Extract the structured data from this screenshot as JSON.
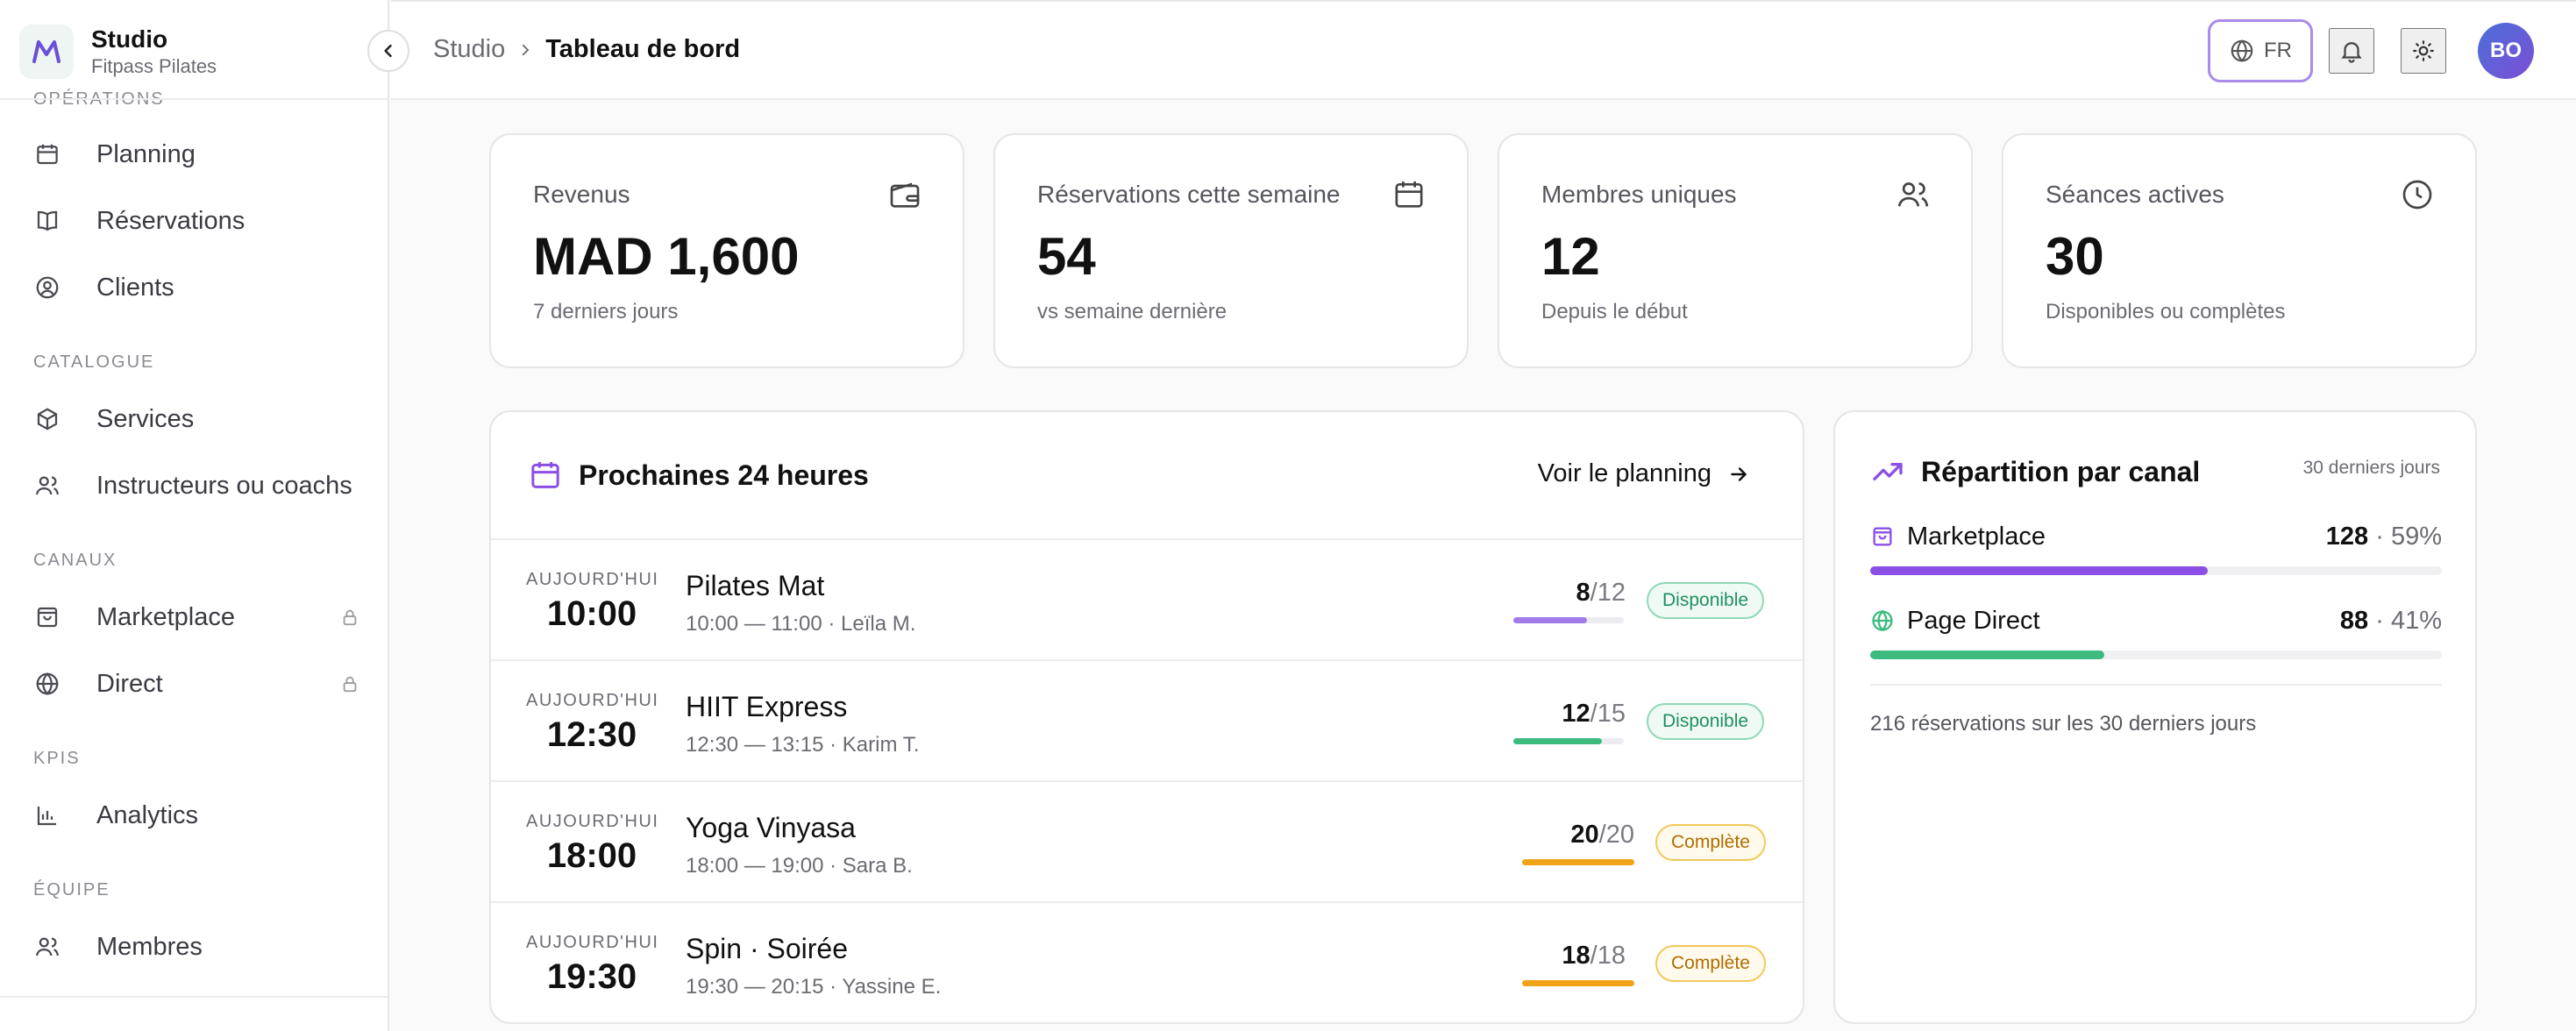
{
  "brand": {
    "name": "Studio",
    "subtitle": "Fitpass Pilates"
  },
  "sidebar": {
    "cut_section": "OPÉRATIONS",
    "sections": {
      "catalogue": "CATALOGUE",
      "canaux": "CANAUX",
      "kpis": "KPIS",
      "equipe": "ÉQUIPE"
    },
    "items": {
      "planning": "Planning",
      "reservations": "Réservations",
      "clients": "Clients",
      "services": "Services",
      "instructeurs": "Instructeurs ou coachs",
      "marketplace": "Marketplace",
      "direct": "Direct",
      "analytics": "Analytics",
      "membres": "Membres"
    }
  },
  "topbar": {
    "breadcrumb_root": "Studio",
    "breadcrumb_current": "Tableau de bord",
    "language": "FR",
    "avatar_initials": "BO"
  },
  "kpis": [
    {
      "label": "Revenus",
      "value": "MAD 1,600",
      "sub": "7 derniers jours"
    },
    {
      "label": "Réservations cette semaine",
      "value": "54",
      "sub": "vs semaine dernière"
    },
    {
      "label": "Membres uniques",
      "value": "12",
      "sub": "Depuis le début"
    },
    {
      "label": "Séances actives",
      "value": "30",
      "sub": "Disponibles ou complètes"
    }
  ],
  "upcoming": {
    "title": "Prochaines 24 heures",
    "see_planning": "Voir le planning",
    "sessions": [
      {
        "day": "AUJOURD'HUI",
        "time": "10:00",
        "name": "Pilates Mat",
        "meta": "10:00 — 11:00 · Leïla M.",
        "booked": "8",
        "capacity": "/12",
        "fill": 0.667,
        "status": "Disponible"
      },
      {
        "day": "AUJOURD'HUI",
        "time": "12:30",
        "name": "HIIT Express",
        "meta": "12:30 — 13:15 · Karim T.",
        "booked": "12",
        "capacity": "/15",
        "fill": 0.8,
        "status": "Disponible"
      },
      {
        "day": "AUJOURD'HUI",
        "time": "18:00",
        "name": "Yoga Vinyasa",
        "meta": "18:00 — 19:00 · Sara B.",
        "booked": "20",
        "capacity": "/20",
        "fill": 1.0,
        "status": "Complète"
      },
      {
        "day": "AUJOURD'HUI",
        "time": "19:30",
        "name": "Spin · Soirée",
        "meta": "19:30 — 20:15 · Yassine E.",
        "booked": "18",
        "capacity": "/18",
        "fill": 1.0,
        "status": "Complète"
      }
    ]
  },
  "repartition": {
    "title": "Répartition par canal",
    "period": "30 derniers jours",
    "channels": [
      {
        "name": "Marketplace",
        "count": "128",
        "pct": "· 59%",
        "fill": 0.59,
        "color": "#8b4fe6"
      },
      {
        "name": "Page Direct",
        "count": "88",
        "pct": "· 41%",
        "fill": 0.41,
        "color": "#3dbb7f"
      }
    ],
    "footer": "216 réservations sur les 30 derniers jours"
  },
  "colors": {
    "accent": "#8b4fe6",
    "available": "#3dbb7f",
    "full": "#f0a318"
  }
}
